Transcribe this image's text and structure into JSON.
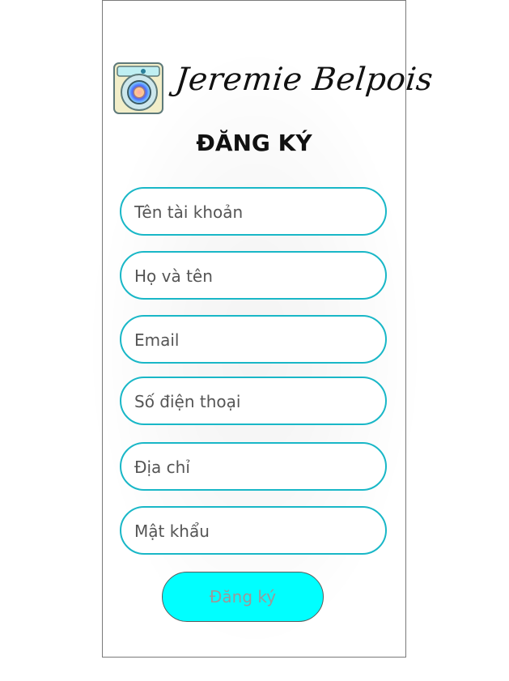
{
  "brand": {
    "name": "Jeremie Belpois",
    "logo_icon": "washing-machine-icon"
  },
  "page": {
    "title": "ĐĂNG KÝ"
  },
  "form": {
    "fields": [
      {
        "placeholder": "Tên tài khoản"
      },
      {
        "placeholder": "Họ và tên"
      },
      {
        "placeholder": "Email"
      },
      {
        "placeholder": "Số điện thoại"
      },
      {
        "placeholder": "Địa chỉ"
      },
      {
        "placeholder": "Mật khẩu"
      }
    ],
    "submit_label": "Đăng ký"
  },
  "colors": {
    "field_border": "#19b7c7",
    "button_bg": "#00ffff"
  }
}
